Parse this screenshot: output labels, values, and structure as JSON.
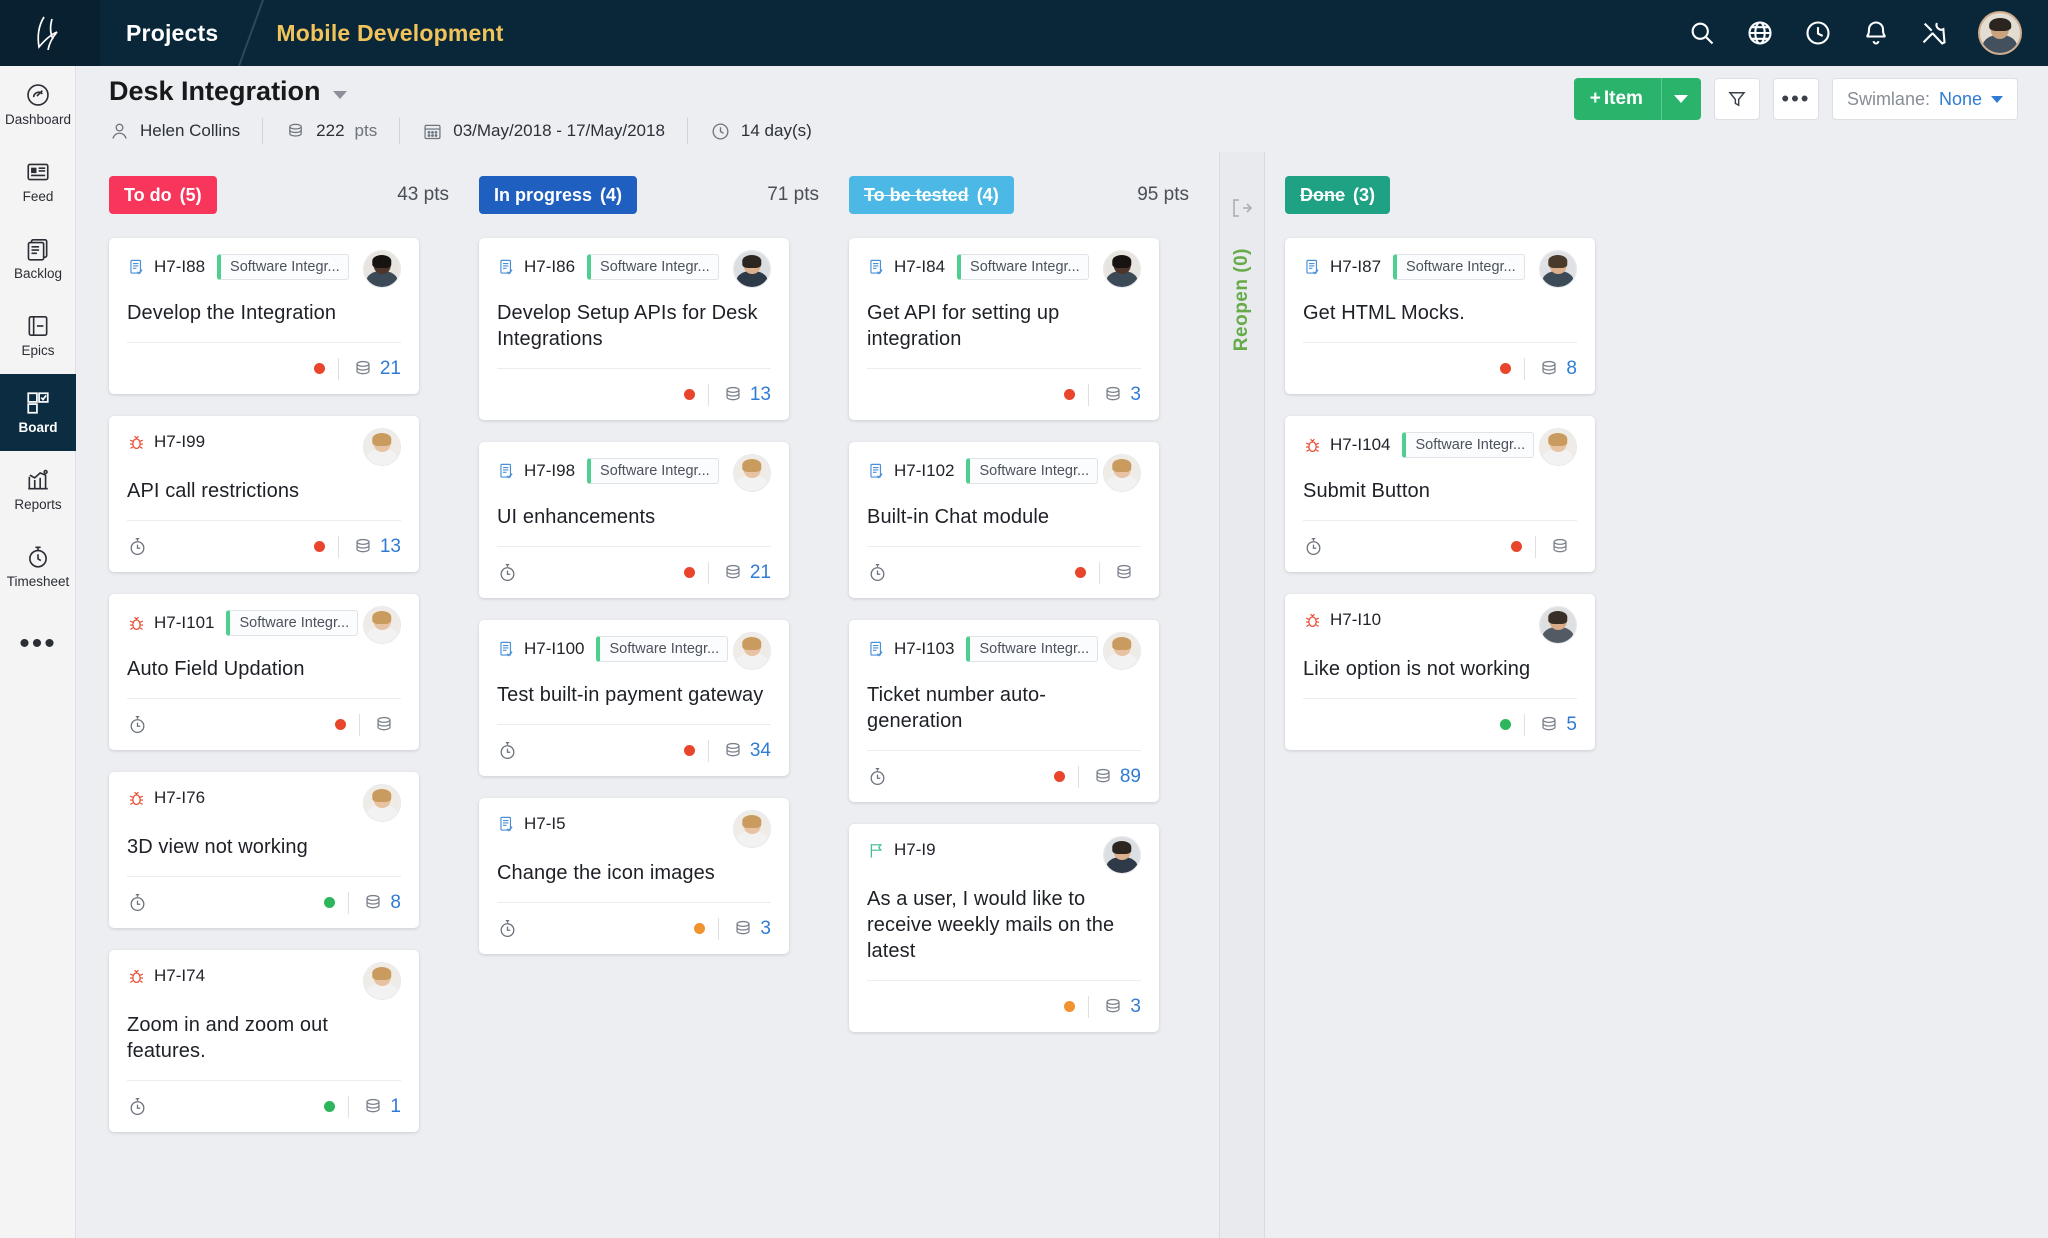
{
  "topbar": {
    "logo": "zoho-projects-logo-icon",
    "app_link": "Projects",
    "project_name": "Mobile Development",
    "icons": [
      {
        "name": "search-icon"
      },
      {
        "name": "globe-icon"
      },
      {
        "name": "clock-icon"
      },
      {
        "name": "bell-icon"
      },
      {
        "name": "tools-icon"
      }
    ],
    "avatar": "user-avatar"
  },
  "sidebar": {
    "items": [
      {
        "label": "Dashboard",
        "icon": "gauge-icon",
        "active": false
      },
      {
        "label": "Feed",
        "icon": "feed-icon",
        "active": false
      },
      {
        "label": "Backlog",
        "icon": "backlog-icon",
        "active": false
      },
      {
        "label": "Epics",
        "icon": "epics-icon",
        "active": false
      },
      {
        "label": "Board",
        "icon": "board-icon",
        "active": true
      },
      {
        "label": "Reports",
        "icon": "reports-chart-icon",
        "active": false
      },
      {
        "label": "Timesheet",
        "icon": "timesheet-stopwatch-icon",
        "active": false
      }
    ],
    "more": "•••"
  },
  "header": {
    "title": "Desk Integration",
    "owner": "Helen Collins",
    "points": "222",
    "points_unit": "pts",
    "date_range": "03/May/2018  -  17/May/2018",
    "duration": "14 day(s)",
    "add_item_label": "Item",
    "add_item_plus": "+",
    "filter_icon": "filter-funnel-icon",
    "more_icon": "ellipsis-icon",
    "swimlane_label": "Swimlane:",
    "swimlane_value": "None"
  },
  "reopen": {
    "label": "Reopen (0)",
    "icon": "exit-arrow-icon"
  },
  "columns": [
    {
      "name": "To do",
      "count": "(5)",
      "points": "43 pts",
      "color": "#f8365c",
      "struck": false,
      "cards": [
        {
          "type": "task",
          "key": "H7-I88",
          "tag": "Software Integr...",
          "title": "Develop the Integration",
          "has_tag": true,
          "has_clock": false,
          "priority_color": "#e8452c",
          "points": "21",
          "avatar": {
            "skin": "#4d352a",
            "hair": "#171310",
            "shirt": "#3c4a57",
            "bg": "#e8e4df"
          }
        },
        {
          "type": "bug",
          "key": "H7-I99",
          "tag": "",
          "title": "API call restrictions",
          "has_tag": false,
          "has_clock": true,
          "priority_color": "#e8452c",
          "points": "13",
          "avatar": {
            "skin": "#e8c3a3",
            "hair": "#c99b5e",
            "shirt": "#f2f2f2",
            "bg": "#efece8"
          }
        },
        {
          "type": "bug",
          "key": "H7-I101",
          "tag": "Software Integr...",
          "title": "Auto Field Updation",
          "has_tag": true,
          "has_clock": true,
          "priority_color": "#e8452c",
          "points": "",
          "avatar": {
            "skin": "#e8c3a3",
            "hair": "#c99b5e",
            "shirt": "#f2f2f2",
            "bg": "#efece8"
          }
        },
        {
          "type": "bug",
          "key": "H7-I76",
          "tag": "",
          "title": "3D view not working",
          "has_tag": false,
          "has_clock": true,
          "priority_color": "#2eb65c",
          "points": "8",
          "avatar": {
            "skin": "#e8c3a3",
            "hair": "#c99b5e",
            "shirt": "#f2f2f2",
            "bg": "#efece8"
          }
        },
        {
          "type": "bug",
          "key": "H7-I74",
          "tag": "",
          "title": "Zoom in and zoom out features.",
          "has_tag": false,
          "has_clock": true,
          "priority_color": "#2eb65c",
          "points": "1",
          "avatar": {
            "skin": "#e8c3a3",
            "hair": "#c99b5e",
            "shirt": "#f2f2f2",
            "bg": "#efece8"
          }
        }
      ]
    },
    {
      "name": "In progress",
      "count": "(4)",
      "points": "71 pts",
      "color": "#1f5fc0",
      "struck": false,
      "cards": [
        {
          "type": "task",
          "key": "H7-I86",
          "tag": "Software Integr...",
          "title": "Develop Setup APIs for Desk Integrations",
          "has_tag": true,
          "has_clock": false,
          "priority_color": "#e8452c",
          "points": "13",
          "avatar": {
            "skin": "#dcb08c",
            "hair": "#2c2520",
            "shirt": "#2e3a48",
            "bg": "#dcdfe2"
          }
        },
        {
          "type": "task",
          "key": "H7-I98",
          "tag": "Software Integr...",
          "title": "UI enhancements",
          "has_tag": true,
          "has_clock": true,
          "priority_color": "#e8452c",
          "points": "21",
          "avatar": {
            "skin": "#e8c3a3",
            "hair": "#c99b5e",
            "shirt": "#f2f2f2",
            "bg": "#efece8"
          }
        },
        {
          "type": "task",
          "key": "H7-I100",
          "tag": "Software Integr...",
          "title": "Test built-in payment gateway",
          "has_tag": true,
          "has_clock": true,
          "priority_color": "#e8452c",
          "points": "34",
          "avatar": {
            "skin": "#e8c3a3",
            "hair": "#c99b5e",
            "shirt": "#f2f2f2",
            "bg": "#efece8"
          }
        },
        {
          "type": "task",
          "key": "H7-I5",
          "tag": "",
          "title": "Change the icon images",
          "has_tag": false,
          "has_clock": true,
          "priority_color": "#f0922e",
          "points": "3",
          "avatar": {
            "skin": "#e8c3a3",
            "hair": "#c99b5e",
            "shirt": "#f2f2f2",
            "bg": "#efece8"
          }
        }
      ]
    },
    {
      "name": "To be tested",
      "count": "(4)",
      "points": "95 pts",
      "color": "#4cb8e5",
      "struck": true,
      "cards": [
        {
          "type": "task",
          "key": "H7-I84",
          "tag": "Software Integr...",
          "title": "Get API for setting up integration",
          "has_tag": true,
          "has_clock": false,
          "priority_color": "#e8452c",
          "points": "3",
          "avatar": {
            "skin": "#4d352a",
            "hair": "#171310",
            "shirt": "#3c4a57",
            "bg": "#e8e4df"
          }
        },
        {
          "type": "task",
          "key": "H7-I102",
          "tag": "Software Integr...",
          "title": "Built-in Chat module",
          "has_tag": true,
          "has_clock": true,
          "priority_color": "#e8452c",
          "points": "",
          "avatar": {
            "skin": "#e8c3a3",
            "hair": "#c99b5e",
            "shirt": "#f2f2f2",
            "bg": "#efece8"
          }
        },
        {
          "type": "task",
          "key": "H7-I103",
          "tag": "Software Integr...",
          "title": "Ticket number auto-generation",
          "has_tag": true,
          "has_clock": true,
          "priority_color": "#e8452c",
          "points": "89",
          "avatar": {
            "skin": "#e8c3a3",
            "hair": "#c99b5e",
            "shirt": "#f2f2f2",
            "bg": "#efece8"
          }
        },
        {
          "type": "story",
          "key": "H7-I9",
          "tag": "",
          "title": "As a user, I would like to receive weekly mails on the latest",
          "has_tag": false,
          "has_clock": false,
          "priority_color": "#f0922e",
          "points": "3",
          "avatar": {
            "skin": "#dcb08c",
            "hair": "#2c2520",
            "shirt": "#2e3a48",
            "bg": "#dcdfe2"
          }
        }
      ]
    },
    {
      "name": "Done",
      "count": "(3)",
      "points": "",
      "color": "#1fa184",
      "struck": true,
      "cards": [
        {
          "type": "task",
          "key": "H7-I87",
          "tag": "Software Integr...",
          "title": "Get HTML Mocks.",
          "has_tag": true,
          "has_clock": false,
          "priority_color": "#e8452c",
          "points": "8",
          "avatar": {
            "skin": "#dcb08c",
            "hair": "#4a3a2c",
            "shirt": "#3d4a57",
            "bg": "#dfe1e4"
          }
        },
        {
          "type": "bug",
          "key": "H7-I104",
          "tag": "Software Integr...",
          "title": "Submit Button",
          "has_tag": true,
          "has_clock": true,
          "priority_color": "#e8452c",
          "points": "",
          "avatar": {
            "skin": "#e8c3a3",
            "hair": "#c99b5e",
            "shirt": "#f2f2f2",
            "bg": "#efece8"
          }
        },
        {
          "type": "bug",
          "key": "H7-I10",
          "tag": "",
          "title": "Like option is not working",
          "has_tag": false,
          "has_clock": false,
          "priority_color": "#2eb65c",
          "points": "5",
          "avatar": {
            "skin": "#d9ab87",
            "hair": "#3a2f26",
            "shirt": "#525a64",
            "bg": "#dedfe1"
          }
        }
      ]
    }
  ]
}
